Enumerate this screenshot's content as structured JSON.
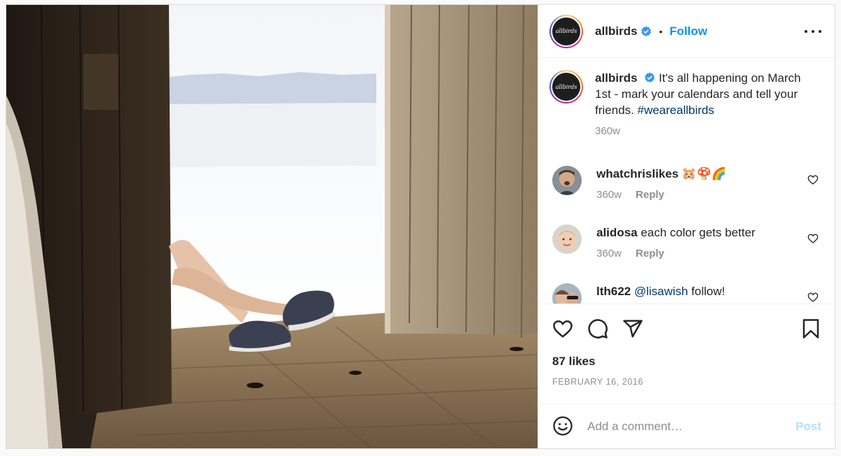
{
  "post": {
    "account": {
      "username": "allbirds",
      "avatar_text": "allbirds",
      "verified": true,
      "separator": "•",
      "follow_label": "Follow"
    },
    "caption": {
      "username": "allbirds",
      "text": "It's all happening on March 1st - mark your calendars and tell your friends.",
      "hashtag": "#weareallbirds",
      "time": "360w"
    },
    "comments": [
      {
        "username": "whatchrislikes",
        "text": "🐹🍄🌈",
        "time": "360w",
        "reply_label": "Reply"
      },
      {
        "username": "alidosa",
        "text": "each color gets better",
        "time": "360w",
        "reply_label": "Reply"
      },
      {
        "username": "lth622",
        "mention": "@lisawish",
        "text": "follow!"
      }
    ],
    "likes": "87 likes",
    "date": "FEBRUARY 16, 2016",
    "add_comment": {
      "placeholder": "Add a comment…",
      "post_label": "Post"
    },
    "icons": [
      "heart-icon",
      "comment-icon",
      "share-icon",
      "bookmark-icon",
      "more-icon",
      "emoji-icon",
      "verified-icon"
    ],
    "colors": {
      "link": "#0095f6",
      "hashtag": "#00376b",
      "muted": "#8e8e8e",
      "post_disabled": "#b2dffc",
      "verified": "#3897f0"
    }
  }
}
